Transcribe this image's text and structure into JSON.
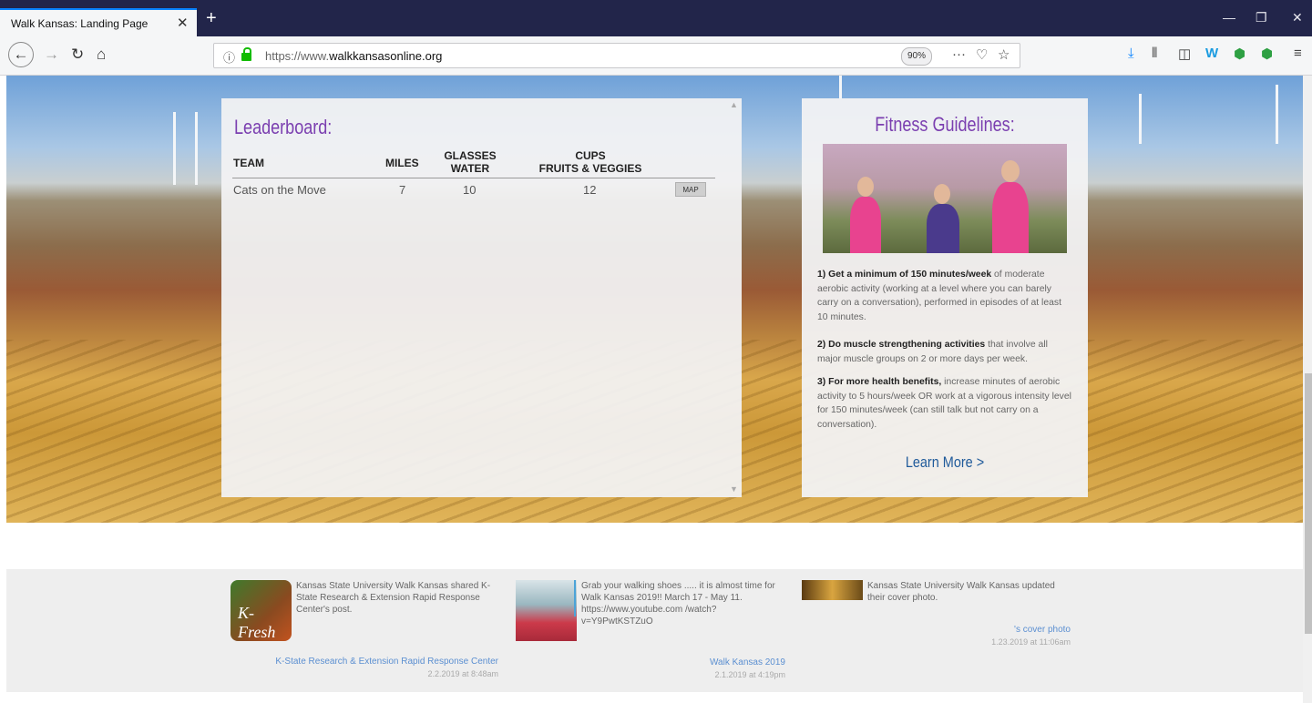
{
  "browser": {
    "tab_title": "Walk Kansas: Landing Page",
    "tab_close": "✕",
    "new_tab": "+",
    "url_prefix": "https://www.",
    "url_domain": "walkkansasonline.org",
    "zoom": "90%",
    "window_controls": [
      "—",
      "❐",
      "✕"
    ]
  },
  "leaderboard": {
    "title": "Leaderboard:",
    "headers": {
      "team": "TEAM",
      "miles": "MILES",
      "glasses_line1": "GLASSES",
      "glasses_line2": "WATER",
      "cups_line1": "CUPS",
      "cups_line2": "FRUITS & VEGGIES"
    },
    "rows": [
      {
        "team": "Cats on the Move",
        "miles": "7",
        "water": "10",
        "cups": "12",
        "map_label": "MAP"
      }
    ]
  },
  "fitness": {
    "title": "Fitness Guidelines:",
    "g1_bold": "1) Get a minimum of 150 minutes/week",
    "g1_rest": " of moderate aerobic activity (working at a level where you can barely carry on a conversation), performed in episodes of at least 10 minutes.",
    "g2_bold": "2) Do muscle strengthening activities",
    "g2_rest": " that involve all major muscle groups on 2 or more days per week.",
    "g3_bold": "3) For more health benefits,",
    "g3_rest": " increase minutes of aerobic activity to 5 hours/week OR work at a vigorous intensity level for 150 minutes/week (can still talk but not carry on a conversation).",
    "learn_more": "Learn More >"
  },
  "feed": [
    {
      "text": "Kansas State University Walk Kansas shared K-State Research & Extension Rapid Response Center's post.",
      "link": "K-State Research & Extension Rapid Response Center",
      "date": "2.2.2019 at 8:48am",
      "thumb_label": "K-Fresh"
    },
    {
      "text": "Grab your walking shoes ..... it is almost time for Walk Kansas 2019!! March 17 - May 11. https://www.youtube.com /watch?v=Y9PwtKSTZuO",
      "link": "Walk Kansas 2019",
      "date": "2.1.2019 at 4:19pm"
    },
    {
      "text": "Kansas State University Walk Kansas updated their cover photo.",
      "link": "'s cover photo",
      "date": "1.23.2019 at 11:06am"
    }
  ],
  "colors": {
    "accent_purple": "#7b3fb0",
    "link_blue": "#1f5a9a",
    "titlebar": "#22254a"
  }
}
